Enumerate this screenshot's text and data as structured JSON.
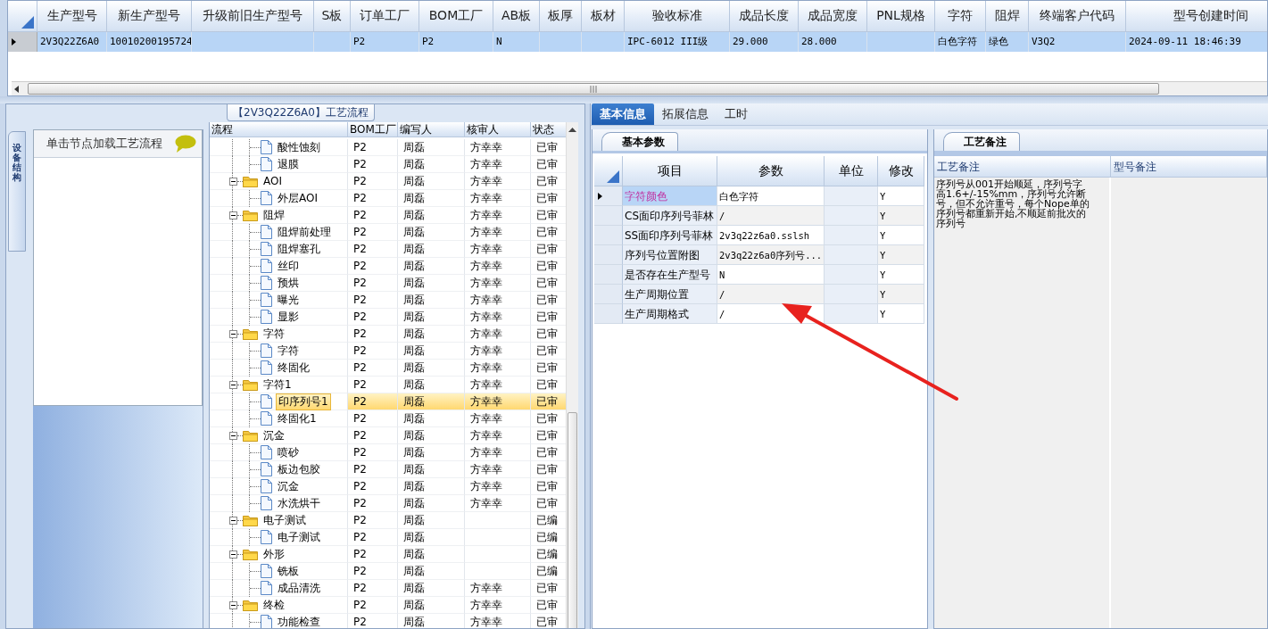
{
  "top_grid": {
    "columns": [
      "生产型号",
      "新生产型号",
      "升级前旧生产型号",
      "S板",
      "订单工厂",
      "BOM工厂",
      "AB板",
      "板厚",
      "板材",
      "验收标准",
      "成品长度",
      "成品宽度",
      "PNL规格",
      "字符",
      "阻焊",
      "终端客户代码",
      "型号创建时间"
    ],
    "rows": [
      {
        "selected": true,
        "cells": [
          "2V3Q22Z6A0",
          "10010200195724",
          "",
          "",
          "P2",
          "P2",
          "N",
          "",
          "",
          "IPC-6012 III级",
          "29.000",
          "28.000",
          "",
          "白色字符",
          "绿色",
          "V3Q2",
          "2024-09-11 18:46:39"
        ]
      }
    ]
  },
  "process_panel": {
    "title": "【2V3Q22Z6A0】工艺流程",
    "side_tab": "设备结构",
    "hint": "单击节点加载工艺流程",
    "tree": {
      "columns": [
        "流程",
        "BOM工厂",
        "编写人",
        "核审人",
        "状态"
      ],
      "rows": [
        {
          "kind": "step",
          "name": "酸性蚀刻",
          "factory": "P2",
          "author": "周磊",
          "reviewer": "方幸幸",
          "status": "已审",
          "selected": false
        },
        {
          "kind": "step",
          "name": "退膜",
          "factory": "P2",
          "author": "周磊",
          "reviewer": "方幸幸",
          "status": "已审",
          "selected": false
        },
        {
          "kind": "group",
          "name": "AOI",
          "factory": "P2",
          "author": "周磊",
          "reviewer": "方幸幸",
          "status": "已审",
          "expanded": true,
          "selected": false,
          "children": [
            {
              "kind": "step",
              "name": "外层AOI",
              "factory": "P2",
              "author": "周磊",
              "reviewer": "方幸幸",
              "status": "已审",
              "selected": false
            }
          ]
        },
        {
          "kind": "group",
          "name": "阻焊",
          "factory": "P2",
          "author": "周磊",
          "reviewer": "方幸幸",
          "status": "已审",
          "expanded": true,
          "selected": false,
          "children": [
            {
              "kind": "step",
              "name": "阻焊前处理",
              "factory": "P2",
              "author": "周磊",
              "reviewer": "方幸幸",
              "status": "已审",
              "selected": false
            },
            {
              "kind": "step",
              "name": "阻焊塞孔",
              "factory": "P2",
              "author": "周磊",
              "reviewer": "方幸幸",
              "status": "已审",
              "selected": false
            },
            {
              "kind": "step",
              "name": "丝印",
              "factory": "P2",
              "author": "周磊",
              "reviewer": "方幸幸",
              "status": "已审",
              "selected": false
            },
            {
              "kind": "step",
              "name": "预烘",
              "factory": "P2",
              "author": "周磊",
              "reviewer": "方幸幸",
              "status": "已审",
              "selected": false
            },
            {
              "kind": "step",
              "name": "曝光",
              "factory": "P2",
              "author": "周磊",
              "reviewer": "方幸幸",
              "status": "已审",
              "selected": false
            },
            {
              "kind": "step",
              "name": "显影",
              "factory": "P2",
              "author": "周磊",
              "reviewer": "方幸幸",
              "status": "已审",
              "selected": false
            }
          ]
        },
        {
          "kind": "group",
          "name": "字符",
          "factory": "P2",
          "author": "周磊",
          "reviewer": "方幸幸",
          "status": "已审",
          "expanded": true,
          "selected": false,
          "children": [
            {
              "kind": "step",
              "name": "字符",
              "factory": "P2",
              "author": "周磊",
              "reviewer": "方幸幸",
              "status": "已审",
              "selected": false
            },
            {
              "kind": "step",
              "name": "终固化",
              "factory": "P2",
              "author": "周磊",
              "reviewer": "方幸幸",
              "status": "已审",
              "selected": false
            }
          ]
        },
        {
          "kind": "group",
          "name": "字符1",
          "factory": "P2",
          "author": "周磊",
          "reviewer": "方幸幸",
          "status": "已审",
          "expanded": true,
          "selected": false,
          "children": [
            {
              "kind": "step",
              "name": "印序列号1",
              "factory": "P2",
              "author": "周磊",
              "reviewer": "方幸幸",
              "status": "已审",
              "selected": true
            },
            {
              "kind": "step",
              "name": "终固化1",
              "factory": "P2",
              "author": "周磊",
              "reviewer": "方幸幸",
              "status": "已审",
              "selected": false
            }
          ]
        },
        {
          "kind": "group",
          "name": "沉金",
          "factory": "P2",
          "author": "周磊",
          "reviewer": "方幸幸",
          "status": "已审",
          "expanded": true,
          "selected": false,
          "children": [
            {
              "kind": "step",
              "name": "喷砂",
              "factory": "P2",
              "author": "周磊",
              "reviewer": "方幸幸",
              "status": "已审",
              "selected": false
            },
            {
              "kind": "step",
              "name": "板边包胶",
              "factory": "P2",
              "author": "周磊",
              "reviewer": "方幸幸",
              "status": "已审",
              "selected": false
            },
            {
              "kind": "step",
              "name": "沉金",
              "factory": "P2",
              "author": "周磊",
              "reviewer": "方幸幸",
              "status": "已审",
              "selected": false
            },
            {
              "kind": "step",
              "name": "水洗烘干",
              "factory": "P2",
              "author": "周磊",
              "reviewer": "方幸幸",
              "status": "已审",
              "selected": false
            }
          ]
        },
        {
          "kind": "group",
          "name": "电子测试",
          "factory": "P2",
          "author": "周磊",
          "status": "已编",
          "expanded": true,
          "selected": false,
          "children": [
            {
              "kind": "step",
              "name": "电子测试",
              "factory": "P2",
              "author": "周磊",
              "status": "已编",
              "selected": false
            }
          ]
        },
        {
          "kind": "group",
          "name": "外形",
          "factory": "P2",
          "author": "周磊",
          "status": "已编",
          "expanded": true,
          "selected": false,
          "children": [
            {
              "kind": "step",
              "name": "铣板",
              "factory": "P2",
              "author": "周磊",
              "status": "已编",
              "selected": false
            },
            {
              "kind": "step",
              "name": "成品清洗",
              "factory": "P2",
              "author": "周磊",
              "reviewer": "方幸幸",
              "status": "已审",
              "selected": false
            }
          ]
        },
        {
          "kind": "group",
          "name": "终检",
          "factory": "P2",
          "author": "周磊",
          "reviewer": "方幸幸",
          "status": "已审",
          "expanded": true,
          "selected": false,
          "children": [
            {
              "kind": "step",
              "name": "功能检查",
              "factory": "P2",
              "author": "周磊",
              "reviewer": "方幸幸",
              "status": "已审",
              "selected": false
            }
          ]
        }
      ]
    }
  },
  "info_tabs": [
    {
      "label": "基本信息",
      "selected": true
    },
    {
      "label": "拓展信息",
      "selected": false
    },
    {
      "label": "工时",
      "selected": false
    }
  ],
  "params": {
    "tab": "基本参数",
    "columns": [
      "项目",
      "参数",
      "单位",
      "修改"
    ],
    "rows": [
      {
        "item": "字符颜色",
        "value": "白色字符",
        "modify": "Y",
        "selected": true
      },
      {
        "item": "CS面印序列号菲林",
        "value": "/",
        "modify": "Y",
        "selected": false
      },
      {
        "item": "SS面印序列号菲林",
        "value": "2v3q22z6a0.sslsh",
        "modify": "Y",
        "selected": false
      },
      {
        "item": "序列号位置附图",
        "value": "2v3q22z6a0序列号...",
        "modify": "Y",
        "selected": false
      },
      {
        "item": "是否存在生产型号",
        "value": "N",
        "modify": "Y",
        "selected": false
      },
      {
        "item": "生产周期位置",
        "value": "/",
        "modify": "Y",
        "selected": false
      },
      {
        "item": "生产周期格式",
        "value": "/",
        "modify": "Y",
        "selected": false
      }
    ]
  },
  "remarks": {
    "tab": "工艺备注",
    "columns": [
      "工艺备注",
      "型号备注"
    ],
    "process_note": "序列号从001开始顺延，序列号字高1.6+/-15%mm，序列号允许断号，但不允许重号，每个Nope单的序列号都重新开始,不顺延前批次的序列号"
  }
}
